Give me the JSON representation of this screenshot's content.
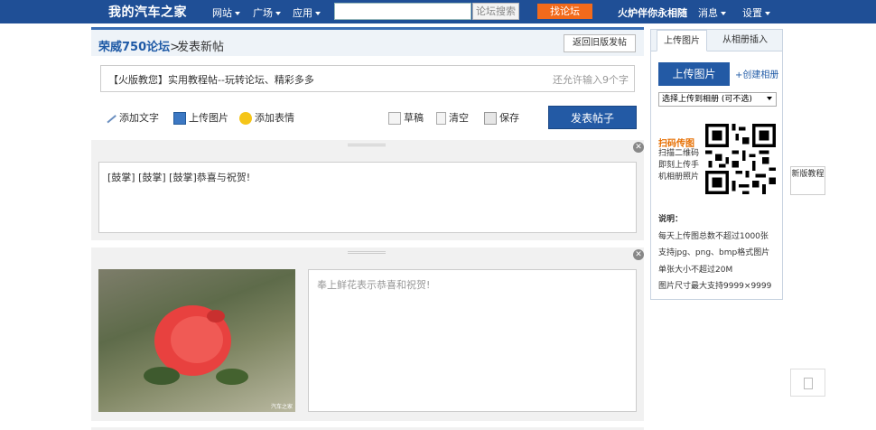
{
  "topbar": {
    "logo": "我的汽车之家",
    "nav": [
      "网站",
      "广场",
      "应用"
    ],
    "search_placeholder": "",
    "search_button": "论坛搜索",
    "find_button": "找论坛",
    "slogan": "火炉伴你永相随",
    "right_nav": [
      "消息",
      "设置"
    ]
  },
  "header": {
    "forum_name": "荣威750论坛",
    "separator": ">",
    "page_title": "发表新帖",
    "old_version_button": "返回旧版发帖"
  },
  "subject": {
    "value": "【火版教您】实用教程帖--玩转论坛、精彩多多",
    "hint": "还允许输入9个字"
  },
  "toolbar": {
    "add_text": "添加文字",
    "upload_image": "上传图片",
    "add_emoji": "添加表情",
    "draft": "草稿",
    "clear": "清空",
    "save": "保存",
    "publish": "发表帖子"
  },
  "blocks": [
    {
      "text": "[鼓掌] [鼓掌] [鼓掌]恭喜与祝贺!"
    },
    {
      "caption_placeholder": "奉上鲜花表示恭喜和祝贺!",
      "image_watermark": "汽车之家"
    }
  ],
  "sidebar": {
    "tabs": [
      "上传图片",
      "从相册插入"
    ],
    "upload_button": "上传图片",
    "create_album": "+创建相册",
    "album_select": "选择上传到相册 (可不选)",
    "qr_title": "扫码传图",
    "qr_desc": "扫描二维码即刻上传手机相册照片",
    "note_title": "说明：",
    "notes": [
      "每天上传图总数不超过1000张",
      "支持jpg、png、bmp格式图片",
      "单张大小不超过20M",
      "图片尺寸最大支持9999×9999"
    ]
  },
  "float": {
    "new_tutorial": "新版教程"
  },
  "colors": {
    "topbar": "#1f4f96",
    "primary_button": "#235aa5",
    "orange": "#f26a1b",
    "link": "#1f5aa6"
  }
}
